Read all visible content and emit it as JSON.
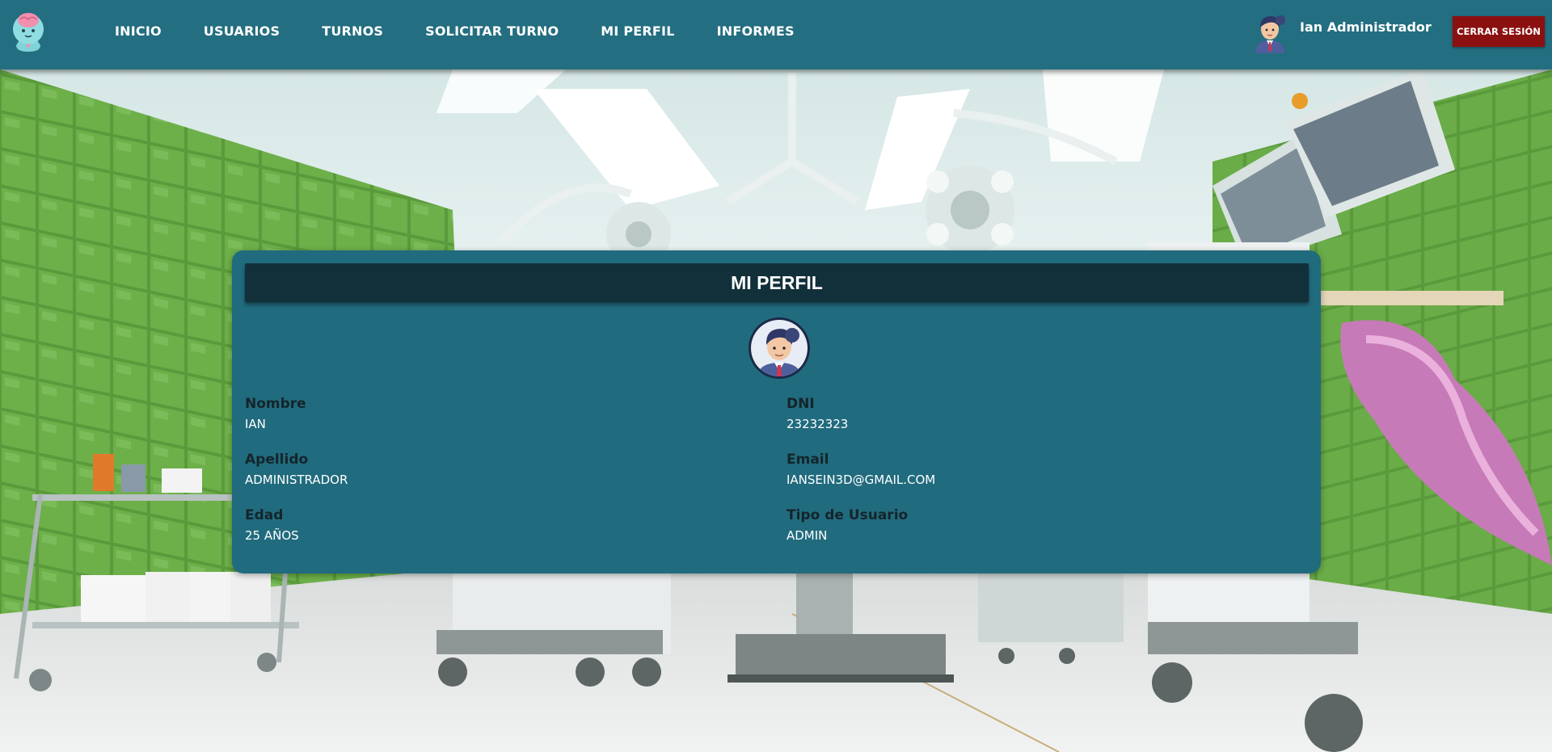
{
  "brand": {
    "logo_icon": "brain-mascot-icon"
  },
  "nav": {
    "items": [
      {
        "label": "INICIO"
      },
      {
        "label": "USUARIOS"
      },
      {
        "label": "TURNOS"
      },
      {
        "label": "SOLICITAR TURNO"
      },
      {
        "label": "MI PERFIL"
      },
      {
        "label": "INFORMES"
      }
    ]
  },
  "user": {
    "name": "Ian Administrador",
    "avatar_icon": "admin-avatar-icon",
    "logout_label": "CERRAR SESIÓN"
  },
  "profile": {
    "title": "MI PERFIL",
    "avatar_icon": "admin-avatar-icon",
    "fields": [
      {
        "label": "Nombre",
        "value": "IAN"
      },
      {
        "label": "DNI",
        "value": "23232323"
      },
      {
        "label": "Apellido",
        "value": "ADMINISTRADOR"
      },
      {
        "label": "Email",
        "value": "IANSEIN3D@GMAIL.COM"
      },
      {
        "label": "Edad",
        "value": "25 AÑOS"
      },
      {
        "label": "Tipo de Usuario",
        "value": "ADMIN"
      }
    ]
  },
  "colors": {
    "navbar": "#236e80",
    "card": "#216b7e",
    "card_header": "#12303a",
    "logout": "#8b1010",
    "label_text": "#14252b"
  }
}
